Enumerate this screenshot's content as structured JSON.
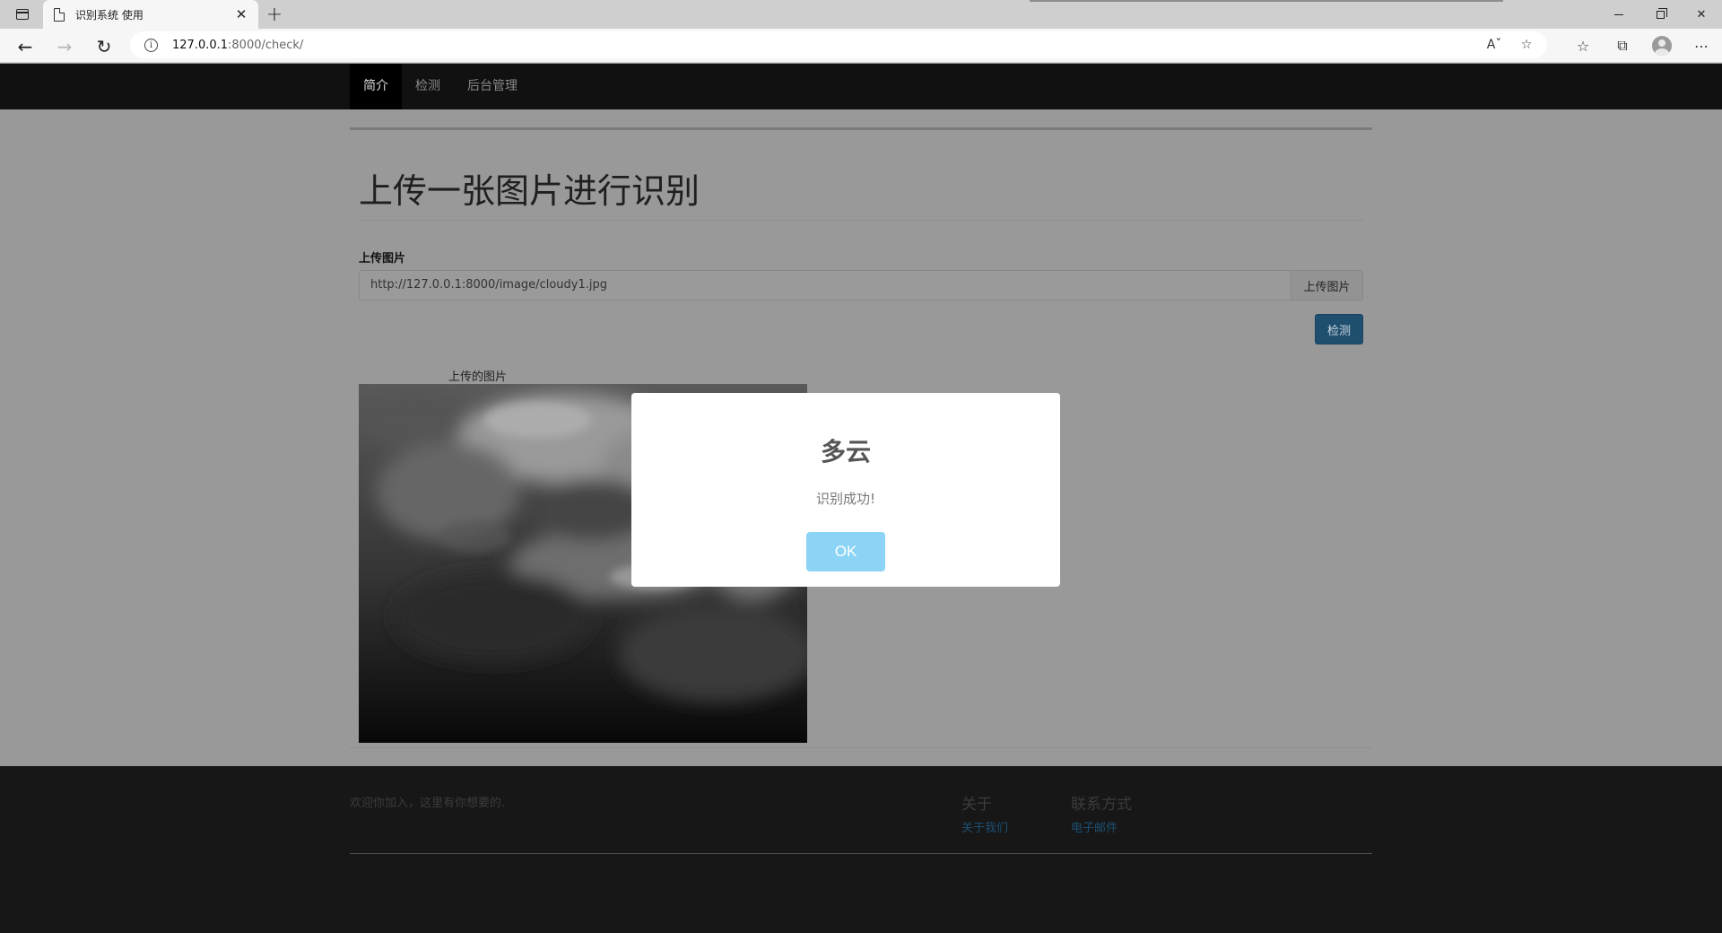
{
  "browser": {
    "tab_title": "识别系统 使用",
    "url_host": "127.0.0.1",
    "url_path": ":8000/check/"
  },
  "site_nav": {
    "items": [
      {
        "label": "简介",
        "active": true
      },
      {
        "label": "检测",
        "active": false
      },
      {
        "label": "后台管理",
        "active": false
      }
    ]
  },
  "page": {
    "title": "上传一张图片进行识别",
    "upload_label": "上传图片",
    "image_url_value": "http://127.0.0.1:8000/image/cloudy1.jpg",
    "upload_button": "上传图片",
    "detect_button": "检测",
    "image_caption": "上传的图片"
  },
  "footer": {
    "welcome": "欢迎你加入，这里有你想要的.",
    "about_title": "关于",
    "about_link": "关于我们",
    "contact_title": "联系方式",
    "contact_link": "电子邮件"
  },
  "modal": {
    "title": "多云",
    "message": "识别成功!",
    "ok_button": "OK",
    "ok_color": "#8cd4f5"
  }
}
